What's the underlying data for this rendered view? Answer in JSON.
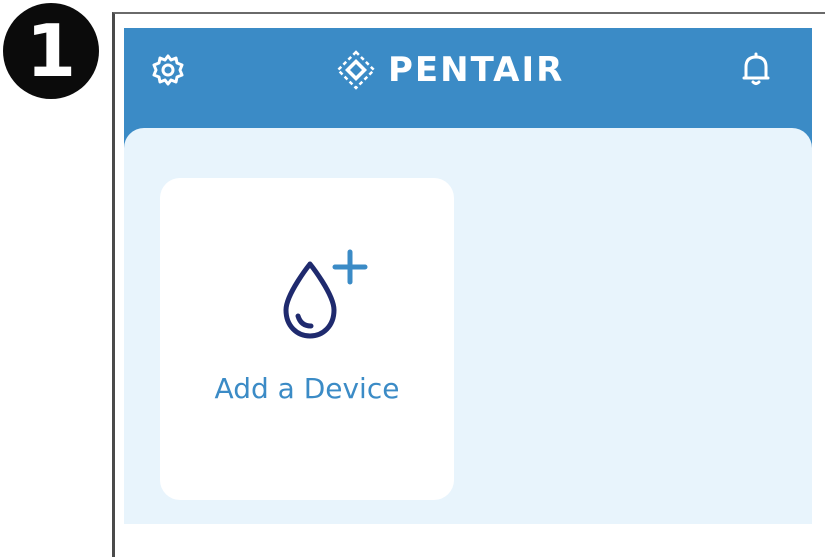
{
  "step_marker": {
    "number": "1"
  },
  "header": {
    "brand_name": "PENTAIR",
    "settings_icon": "gear-icon",
    "notifications_icon": "bell-icon",
    "logo_icon": "pentair-diamond-logo-icon",
    "background_color": "#3b8bc6"
  },
  "content": {
    "background_color": "#e8f4fc",
    "add_device_card": {
      "label": "Add a Device",
      "icon": "water-drop-plus-icon",
      "icon_color": "#1f2a6e",
      "accent_color": "#3b8bc6"
    }
  }
}
